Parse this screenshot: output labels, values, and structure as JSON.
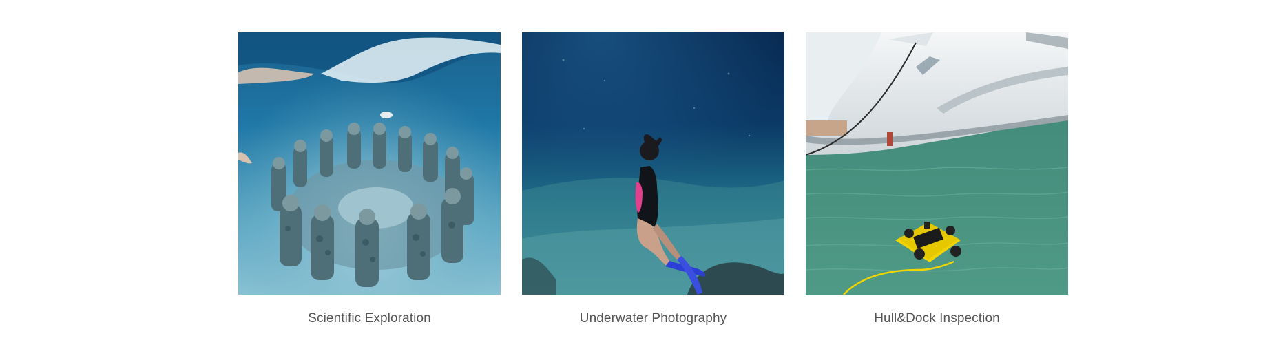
{
  "gallery": {
    "items": [
      {
        "caption": "Scientific Exploration",
        "image": "underwater-statues-photo"
      },
      {
        "caption": "Underwater Photography",
        "image": "freediver-photo"
      },
      {
        "caption": "Hull&Dock Inspection",
        "image": "underwater-drone-photo"
      }
    ]
  },
  "colors": {
    "caption_text": "#555555",
    "background": "#ffffff",
    "deep_sea": "#0b2a55",
    "shallow_sea": "#2f8fb8",
    "harbor_water": "#3f8a78",
    "drone_yellow": "#f2d400"
  }
}
